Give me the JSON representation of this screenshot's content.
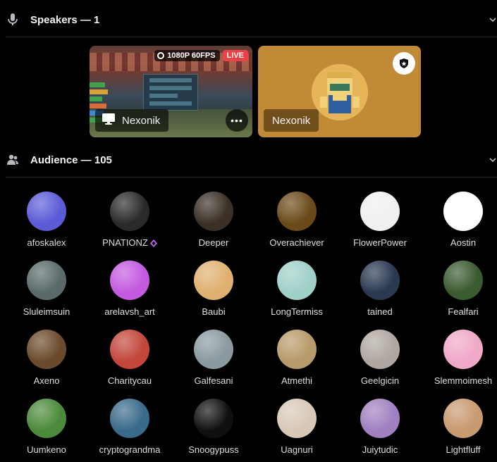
{
  "speakers": {
    "title": "Speakers — 1",
    "stream": {
      "quality": "1080P 60FPS",
      "live": "LIVE",
      "name": "Nexonik"
    },
    "camera": {
      "name": "Nexonik"
    }
  },
  "audience": {
    "title": "Audience — 105",
    "members": [
      {
        "name": "afoskalex",
        "color": "#5b5bd6"
      },
      {
        "name": "PNATIONZ",
        "color": "#2a2a2a",
        "badge": true
      },
      {
        "name": "Deeper",
        "color": "#3a3026"
      },
      {
        "name": "Overachiever",
        "color": "#6b4a1a"
      },
      {
        "name": "FlowerPower",
        "color": "#f0f0f0"
      },
      {
        "name": "Aostin",
        "color": "#ffffff"
      },
      {
        "name": "Sluleimsuin",
        "color": "#5a6a6a"
      },
      {
        "name": "arelavsh_art",
        "color": "#c35ae0"
      },
      {
        "name": "Baubi",
        "color": "#e0b070"
      },
      {
        "name": "LongTermiss",
        "color": "#9fd0c8"
      },
      {
        "name": "tained",
        "color": "#2a3850"
      },
      {
        "name": "Fealfari",
        "color": "#3a5a30"
      },
      {
        "name": "Axeno",
        "color": "#6a4a2a"
      },
      {
        "name": "Charitycau",
        "color": "#c2463a"
      },
      {
        "name": "Galfesani",
        "color": "#8a9aa0"
      },
      {
        "name": "Atmethi",
        "color": "#b89a6a"
      },
      {
        "name": "Geelgicin",
        "color": "#b0a8a0"
      },
      {
        "name": "Slemmoimesh",
        "color": "#f0a8c8"
      },
      {
        "name": "Uumkeno",
        "color": "#4a8a3a"
      },
      {
        "name": "cryptograndma",
        "color": "#3a6a8a"
      },
      {
        "name": "Snoogypuss",
        "color": "#101010"
      },
      {
        "name": "Uagnuri",
        "color": "#d8c8b8"
      },
      {
        "name": "Juiytudic",
        "color": "#a080c0"
      },
      {
        "name": "Lightfluff",
        "color": "#c89a70"
      }
    ]
  }
}
